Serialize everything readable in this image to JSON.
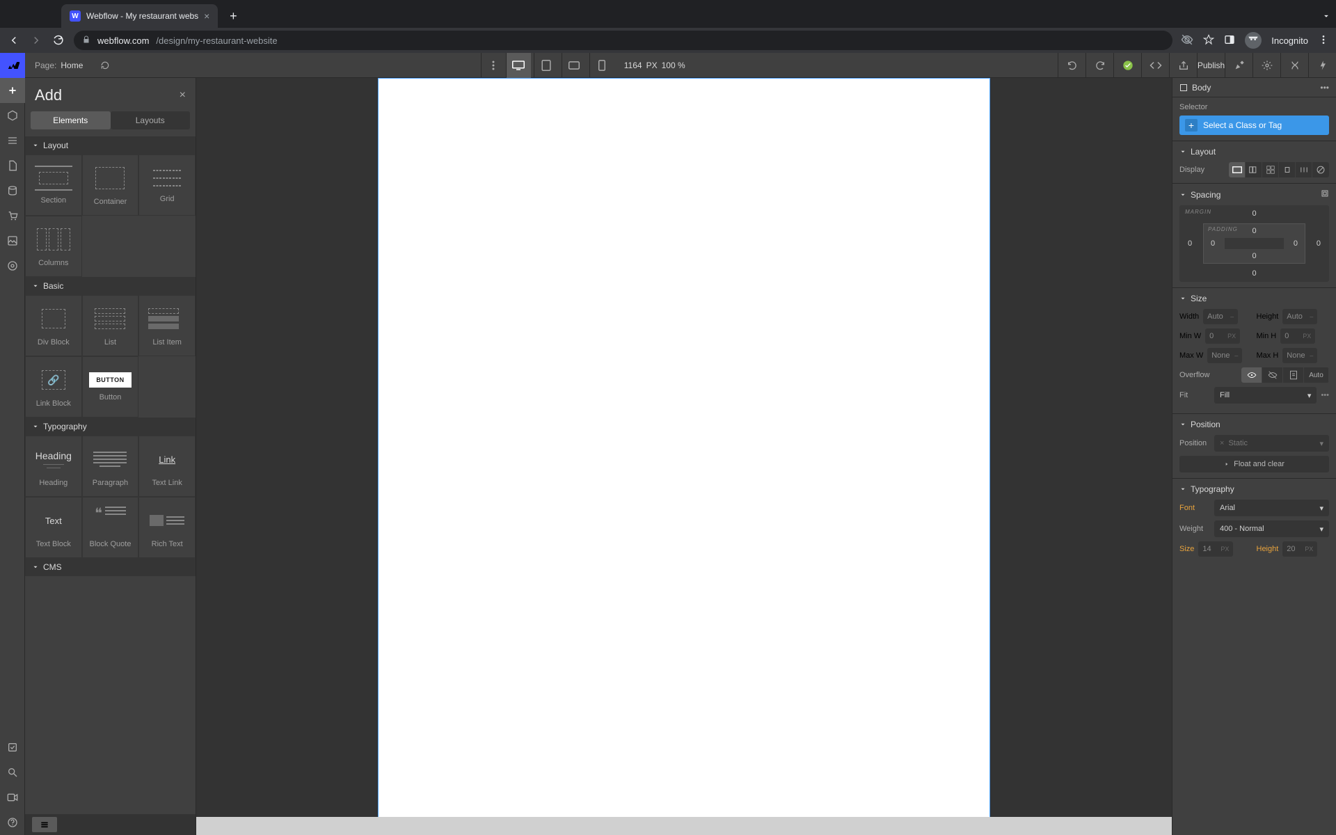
{
  "browser": {
    "tab_title": "Webflow - My restaurant webs",
    "url_host": "webflow.com",
    "url_path": "/design/my-restaurant-website",
    "incognito": "Incognito"
  },
  "topbar": {
    "page_label": "Page:",
    "page_name": "Home",
    "canvas_width": "1164",
    "canvas_unit": "PX",
    "zoom": "100 %",
    "publish": "Publish"
  },
  "add_panel": {
    "title": "Add",
    "tabs": {
      "elements": "Elements",
      "layouts": "Layouts"
    },
    "sections": {
      "layout": "Layout",
      "basic": "Basic",
      "typography": "Typography",
      "cms": "CMS"
    },
    "layout_items": {
      "section": "Section",
      "container": "Container",
      "grid": "Grid",
      "columns": "Columns"
    },
    "basic_items": {
      "div": "Div Block",
      "list": "List",
      "list_item": "List Item",
      "link_block": "Link Block",
      "button": "Button",
      "button_preview": "BUTTON"
    },
    "typo_items": {
      "heading": "Heading",
      "heading_preview": "Heading",
      "paragraph": "Paragraph",
      "text_link": "Text Link",
      "text_link_preview": "Link",
      "text_block": "Text Block",
      "text_block_preview": "Text",
      "block_quote": "Block Quote",
      "rich_text": "Rich Text"
    }
  },
  "style_panel": {
    "selected_element": "Body",
    "selector_label": "Selector",
    "selector_hint": "Select a Class or Tag",
    "layout_heading": "Layout",
    "display_label": "Display",
    "spacing_heading": "Spacing",
    "margin_label": "MARGIN",
    "padding_label": "PADDING",
    "margin": {
      "top": "0",
      "right": "0",
      "bottom": "0",
      "left": "0"
    },
    "padding": {
      "top": "0",
      "right": "0",
      "bottom": "0",
      "left": "0"
    },
    "size_heading": "Size",
    "size": {
      "width_label": "Width",
      "width": "Auto",
      "height_label": "Height",
      "height": "Auto",
      "minw_label": "Min W",
      "minw": "0",
      "minw_unit": "PX",
      "minh_label": "Min H",
      "minh": "0",
      "minh_unit": "PX",
      "maxw_label": "Max W",
      "maxw": "None",
      "maxh_label": "Max H",
      "maxh": "None",
      "overflow_label": "Overflow",
      "overflow_auto": "Auto",
      "fit_label": "Fit",
      "fit_value": "Fill"
    },
    "position_heading": "Position",
    "position": {
      "label": "Position",
      "value": "Static",
      "float": "Float and clear"
    },
    "typography_heading": "Typography",
    "typography": {
      "font_label": "Font",
      "font_value": "Arial",
      "weight_label": "Weight",
      "weight_value": "400 - Normal",
      "size_label": "Size",
      "size_value": "14",
      "size_unit": "PX",
      "height_label": "Height",
      "height_value": "20",
      "height_unit": "PX"
    }
  }
}
